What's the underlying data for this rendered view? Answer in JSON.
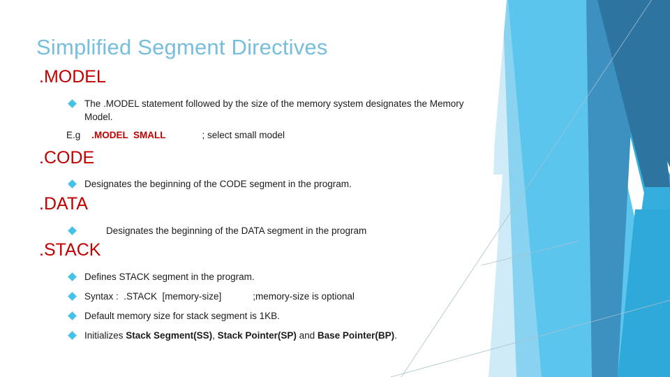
{
  "slide": {
    "title": "Simplified Segment Directives",
    "title_color": "#76BEDB",
    "heading_color": "#C00000",
    "bullet_color": "#45C2E8",
    "body_color": "#1a1a1a"
  },
  "sections": {
    "model": {
      "heading": ".MODEL",
      "bullet": "The .MODEL statement followed by the size of the memory system designates the Memory Model.",
      "example": {
        "label": "E.g",
        "directive": ".MODEL  SMALL",
        "comment": "; select small model"
      }
    },
    "code": {
      "heading": ".CODE",
      "bullet": "Designates the beginning of the CODE segment in the program."
    },
    "data": {
      "heading": ".DATA",
      "bullet": "Designates the beginning of the DATA segment in the program"
    },
    "stack": {
      "heading": ".STACK",
      "bullets": [
        {
          "text": "Defines STACK segment in the program."
        },
        {
          "text": "Syntax :  .STACK  [memory-size]            ;memory-size is optional"
        },
        {
          "text": "Default memory size for stack segment is 1KB."
        }
      ],
      "last_bullet": {
        "prefix": "Initializes ",
        "term1": "Stack Segment(SS)",
        "sep1": ", ",
        "term2": "Stack Pointer(SP)",
        "sep2": " and ",
        "term3": "Base Pointer(BP)",
        "suffix": "."
      }
    }
  },
  "decoration": {
    "name": "angled-blue-bands",
    "colors": {
      "pale_cyan": "#CFEBF8",
      "light_cyan": "#8AD3F0",
      "cyan": "#5BC5EE",
      "mid_blue": "#36AEDD",
      "steel_blue": "#3C91C0",
      "dark_blue": "#2E74A0",
      "hairline": "#9FB8C4"
    }
  }
}
